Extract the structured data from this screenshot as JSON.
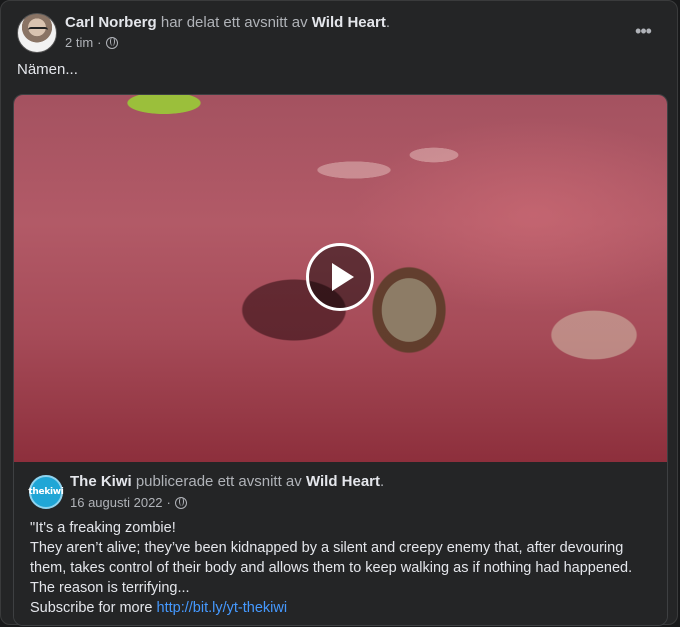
{
  "post": {
    "author": "Carl Norberg",
    "action_text": "har delat ett avsnitt av",
    "page_name": "Wild Heart",
    "period": ".",
    "time": "2 tim",
    "separator": "·",
    "more_label": "•••",
    "text": "Nämen..."
  },
  "shared": {
    "author": "The Kiwi",
    "action_text": "publicerade ett avsnitt av",
    "page_name": "Wild Heart",
    "period": ".",
    "date": "16 augusti 2022",
    "separator": "·",
    "avatar_text": "thekiwi",
    "description": [
      "\"It's a freaking zombie!",
      "They aren’t alive; they’ve been kidnapped by a silent and creepy enemy that, after devouring",
      "them, takes control of their body and allows them to keep walking as if nothing had happened.",
      "The reason is terrifying..."
    ],
    "subscribe_text": "Subscribe for more",
    "link_text": "http://bit.ly/yt-thekiwi"
  },
  "colors": {
    "background": "#18191a",
    "card": "#242526",
    "link": "#4599ff"
  },
  "icons": [
    "globe-icon",
    "more-icon",
    "play-icon"
  ]
}
